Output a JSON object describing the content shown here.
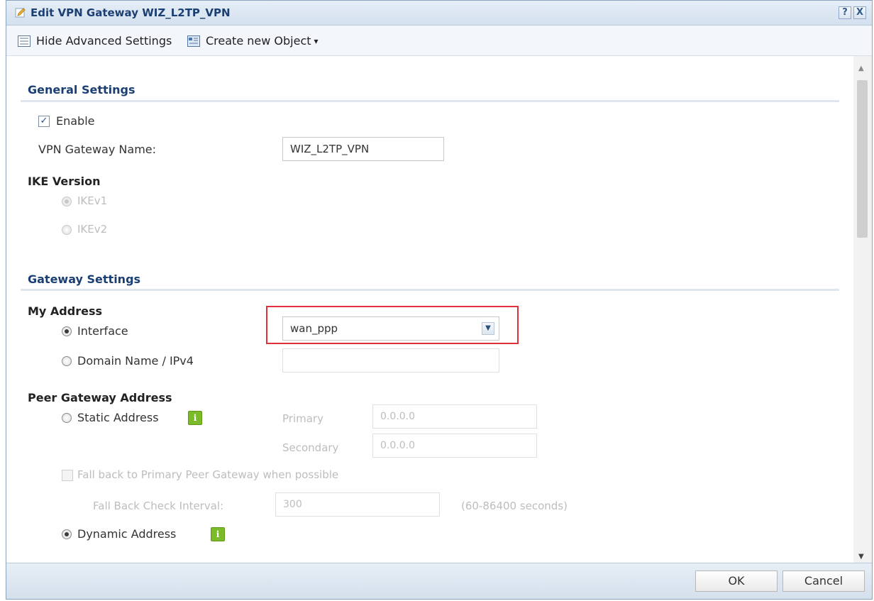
{
  "window": {
    "title": "Edit VPN Gateway WIZ_L2TP_VPN",
    "help": "?",
    "close": "X"
  },
  "toolbar": {
    "hide_advanced": "Hide Advanced Settings",
    "create_object": "Create new Object",
    "create_object_arrow": "▾"
  },
  "general": {
    "header": "General Settings",
    "enable_label": "Enable",
    "enable_checked": true,
    "gateway_name_label": "VPN Gateway Name:",
    "gateway_name_value": "WIZ_L2TP_VPN",
    "ike_header": "IKE Version",
    "ikev1": "IKEv1",
    "ikev2": "IKEv2"
  },
  "gateway": {
    "header": "Gateway Settings",
    "my_address": "My Address",
    "interface_label": "Interface",
    "interface_value": "wan_ppp",
    "domain_label": "Domain Name / IPv4",
    "domain_value": "",
    "peer_header": "Peer Gateway Address",
    "static_label": "Static Address",
    "primary_label": "Primary",
    "primary_value": "0.0.0.0",
    "secondary_label": "Secondary",
    "secondary_value": "0.0.0.0",
    "fallback_label": "Fall back to Primary Peer Gateway when possible",
    "fallback_interval_label": "Fall Back Check Interval:",
    "fallback_interval_value": "300",
    "fallback_interval_range": "(60-86400 seconds)",
    "dynamic_label": "Dynamic Address",
    "info_glyph": "i"
  },
  "footer": {
    "ok": "OK",
    "cancel": "Cancel"
  },
  "colors": {
    "highlight": "#e0303a",
    "title": "#1b3f73",
    "info": "#7bbb2a"
  }
}
